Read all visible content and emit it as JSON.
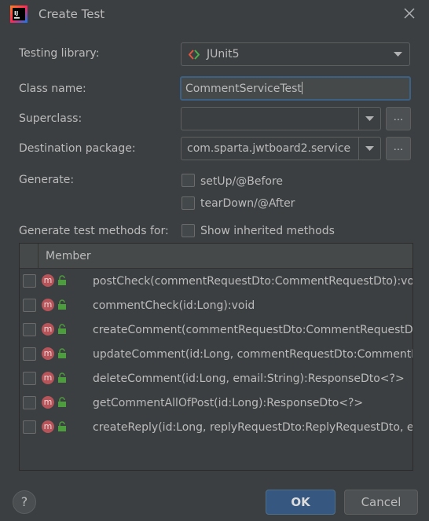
{
  "window": {
    "title": "Create Test",
    "app_icon": "intellij-idea-icon",
    "close_icon": "close-icon"
  },
  "form": {
    "testing_library": {
      "label": "Testing library:",
      "value": "JUnit5",
      "icon": "junit-icon"
    },
    "class_name": {
      "label": "Class name:",
      "value": "CommentServiceTest"
    },
    "superclass": {
      "label": "Superclass:",
      "value": "",
      "browse": "..."
    },
    "destination_package": {
      "label": "Destination package:",
      "value": "com.sparta.jwtboard2.service",
      "browse": "..."
    },
    "generate": {
      "label": "Generate:",
      "options": [
        {
          "label": "setUp/@Before",
          "checked": false
        },
        {
          "label": "tearDown/@After",
          "checked": false
        }
      ]
    },
    "methods_for": {
      "label": "Generate test methods for:",
      "show_inherited": {
        "label": "Show inherited methods",
        "checked": false
      }
    }
  },
  "members_table": {
    "header": "Member",
    "rows": [
      {
        "signature": "postCheck(commentRequestDto:CommentRequestDto):void",
        "checked": false
      },
      {
        "signature": "commentCheck(id:Long):void",
        "checked": false
      },
      {
        "signature": "createComment(commentRequestDto:CommentRequestDto,",
        "checked": false
      },
      {
        "signature": "updateComment(id:Long, commentRequestDto:CommentRe",
        "checked": false
      },
      {
        "signature": "deleteComment(id:Long, email:String):ResponseDto<?>",
        "checked": false
      },
      {
        "signature": "getCommentAllOfPost(id:Long):ResponseDto<?>",
        "checked": false
      },
      {
        "signature": "createReply(id:Long, replyRequestDto:ReplyRequestDto, ema",
        "checked": false
      }
    ],
    "method_badge": "m"
  },
  "footer": {
    "help": "?",
    "ok": "OK",
    "cancel": "Cancel"
  },
  "colors": {
    "background": "#3c3f41",
    "ok_button": "#365880",
    "focus_border": "#3d6185",
    "method_badge": "#b7545a",
    "lock": "#4d9c3d"
  }
}
